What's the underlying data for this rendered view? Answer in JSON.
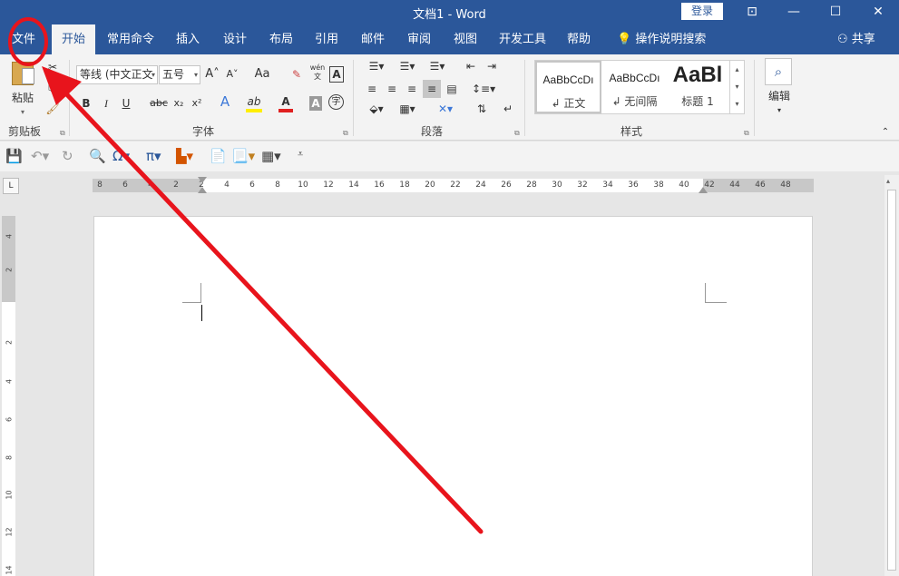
{
  "titlebar": {
    "title": "文档1  -  Word",
    "login": "登录",
    "buttons": [
      "⊡",
      "—",
      "☐",
      "✕"
    ]
  },
  "tabs": [
    {
      "label": "文件"
    },
    {
      "label": "开始"
    },
    {
      "label": "常用命令"
    },
    {
      "label": "插入"
    },
    {
      "label": "设计"
    },
    {
      "label": "布局"
    },
    {
      "label": "引用"
    },
    {
      "label": "邮件"
    },
    {
      "label": "审阅"
    },
    {
      "label": "视图"
    },
    {
      "label": "开发工具"
    },
    {
      "label": "帮助"
    }
  ],
  "tell_me": "操作说明搜索",
  "share": "共享",
  "clipboard": {
    "paste": "粘贴",
    "group": "剪贴板"
  },
  "font": {
    "family": "等线 (中文正文",
    "size": "五号",
    "group": "字体",
    "icons": {
      "grow": "A˄",
      "shrink": "A˅",
      "change_case": "Aa",
      "clear": "✎",
      "phonetic": "wén文",
      "border": "A",
      "bold": "B",
      "italic": "I",
      "underline": "U",
      "strike": "abc",
      "sub": "x₂",
      "sup": "x²",
      "effects": "A",
      "highlight": "ab",
      "color": "A",
      "shading": "A",
      "enclose": "字"
    }
  },
  "paragraph": {
    "group": "段落"
  },
  "styles": {
    "group": "样式",
    "items": [
      {
        "sample": "AaBbCcDı",
        "name": "↲ 正文"
      },
      {
        "sample": "AaBbCcDı",
        "name": "↲ 无间隔"
      },
      {
        "sample": "AaBl",
        "name": "标题 1"
      }
    ]
  },
  "editing": {
    "label": "编辑"
  },
  "ruler": {
    "corner": "L",
    "h_ticks": [
      "8",
      "6",
      "4",
      "2",
      "2",
      "4",
      "6",
      "8",
      "10",
      "12",
      "14",
      "16",
      "18",
      "20",
      "22",
      "24",
      "26",
      "28",
      "30",
      "32",
      "34",
      "36",
      "38",
      "40",
      "42",
      "44",
      "46",
      "48"
    ],
    "v_ticks": [
      "4",
      "2",
      "2",
      "4",
      "6",
      "8",
      "10",
      "12",
      "14"
    ]
  },
  "colors": {
    "title_blue": "#2b579a",
    "annotation_red": "#e8141c"
  }
}
